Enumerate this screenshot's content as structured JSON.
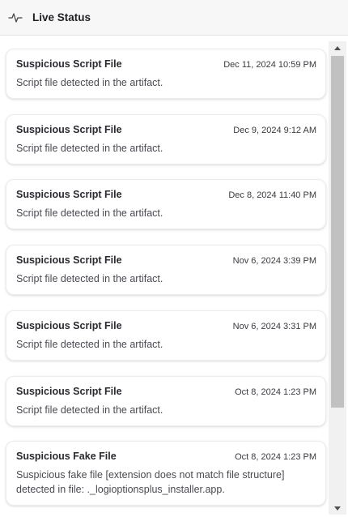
{
  "header": {
    "title": "Live Status",
    "icon": "activity-pulse-icon"
  },
  "cards": [
    {
      "title": "Suspicious Script File",
      "date": "Dec 11, 2024 10:59 PM",
      "description": "Script file detected in the artifact."
    },
    {
      "title": "Suspicious Script File",
      "date": "Dec 9, 2024 9:12 AM",
      "description": "Script file detected in the artifact."
    },
    {
      "title": "Suspicious Script File",
      "date": "Dec 8, 2024 11:40 PM",
      "description": "Script file detected in the artifact."
    },
    {
      "title": "Suspicious Script File",
      "date": "Nov 6, 2024 3:39 PM",
      "description": "Script file detected in the artifact."
    },
    {
      "title": "Suspicious Script File",
      "date": "Nov 6, 2024 3:31 PM",
      "description": "Script file detected in the artifact."
    },
    {
      "title": "Suspicious Script File",
      "date": "Oct 8, 2024 1:23 PM",
      "description": "Script file detected in the artifact."
    },
    {
      "title": "Suspicious Fake File",
      "date": "Oct 8, 2024 1:23 PM",
      "description": "Suspicious fake file [extension does not match file structure] detected in file: ._logioptionsplus_installer.app."
    }
  ],
  "scrollbar": {
    "up_icon": "scroll-up-arrow-icon",
    "down_icon": "scroll-down-arrow-icon"
  }
}
